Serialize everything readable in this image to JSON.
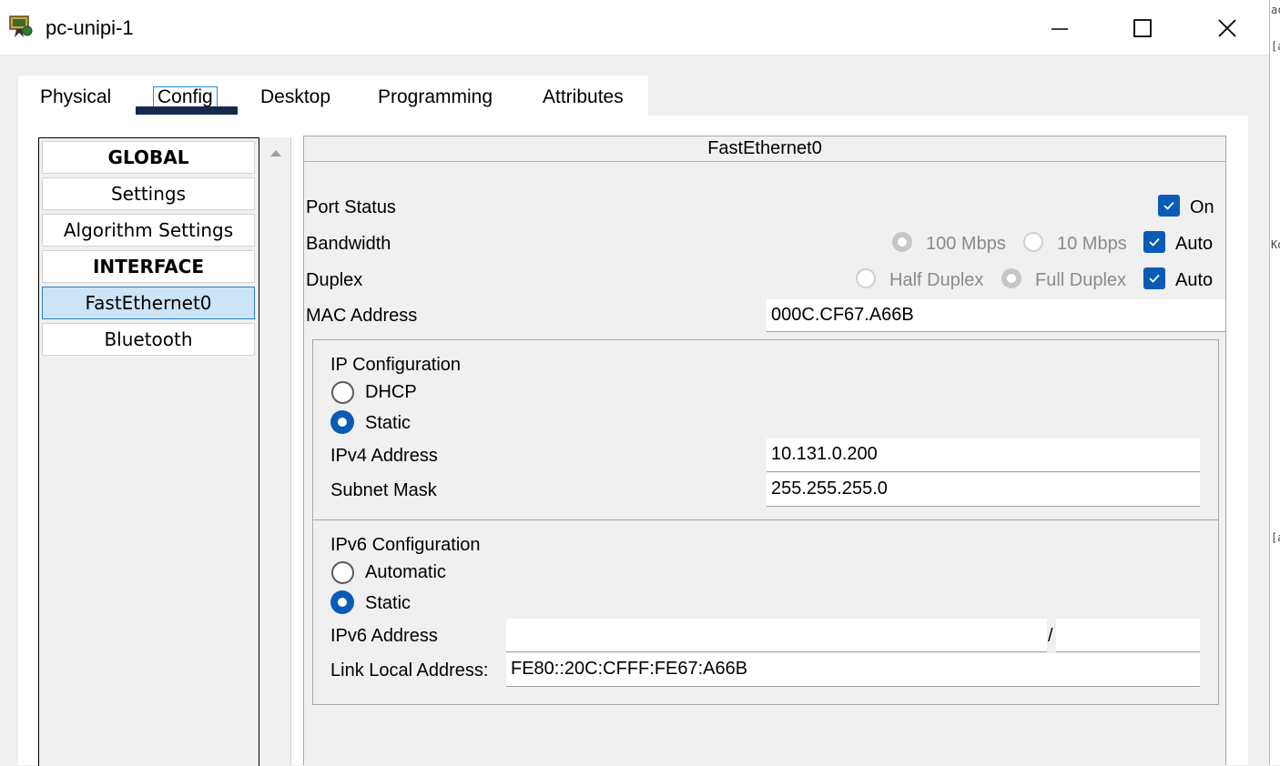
{
  "window": {
    "title": "pc-unipi-1",
    "icon": "network-device-icon",
    "controls": {
      "minimize": "minimize-icon",
      "maximize": "maximize-icon",
      "close": "close-icon"
    }
  },
  "tabs": [
    {
      "label": "Physical"
    },
    {
      "label": "Config",
      "active": true
    },
    {
      "label": "Desktop"
    },
    {
      "label": "Programming"
    },
    {
      "label": "Attributes"
    }
  ],
  "sidebar": {
    "items": [
      {
        "label": "GLOBAL",
        "type": "header"
      },
      {
        "label": "Settings"
      },
      {
        "label": "Algorithm Settings"
      },
      {
        "label": "INTERFACE",
        "type": "header"
      },
      {
        "label": "FastEthernet0",
        "selected": true
      },
      {
        "label": "Bluetooth"
      }
    ]
  },
  "interface": {
    "title": "FastEthernet0",
    "port_status": {
      "label": "Port Status",
      "on_label": "On",
      "on": true
    },
    "bandwidth": {
      "label": "Bandwidth",
      "opt_100": "100 Mbps",
      "opt_10": "10 Mbps",
      "auto_label": "Auto",
      "auto": true
    },
    "duplex": {
      "label": "Duplex",
      "opt_half": "Half Duplex",
      "opt_full": "Full Duplex",
      "auto_label": "Auto",
      "auto": true
    },
    "mac": {
      "label": "MAC Address",
      "value": "000C.CF67.A66B"
    },
    "ipv4": {
      "title": "IP Configuration",
      "dhcp_label": "DHCP",
      "static_label": "Static",
      "mode": "Static",
      "address_label": "IPv4 Address",
      "address": "10.131.0.200",
      "mask_label": "Subnet Mask",
      "mask": "255.255.255.0"
    },
    "ipv6": {
      "title": "IPv6 Configuration",
      "auto_label": "Automatic",
      "static_label": "Static",
      "mode": "Static",
      "address_label": "IPv6 Address",
      "address": "",
      "separator": "/",
      "prefix": "",
      "link_local_label": "Link Local Address:",
      "link_local": "FE80::20C:CFFF:FE67:A66B"
    }
  },
  "colors": {
    "accent": "#0a5bb5",
    "selection": "#cce4f7",
    "tab_underline": "#142a4e",
    "disabled_text": "#8a8a8a"
  }
}
